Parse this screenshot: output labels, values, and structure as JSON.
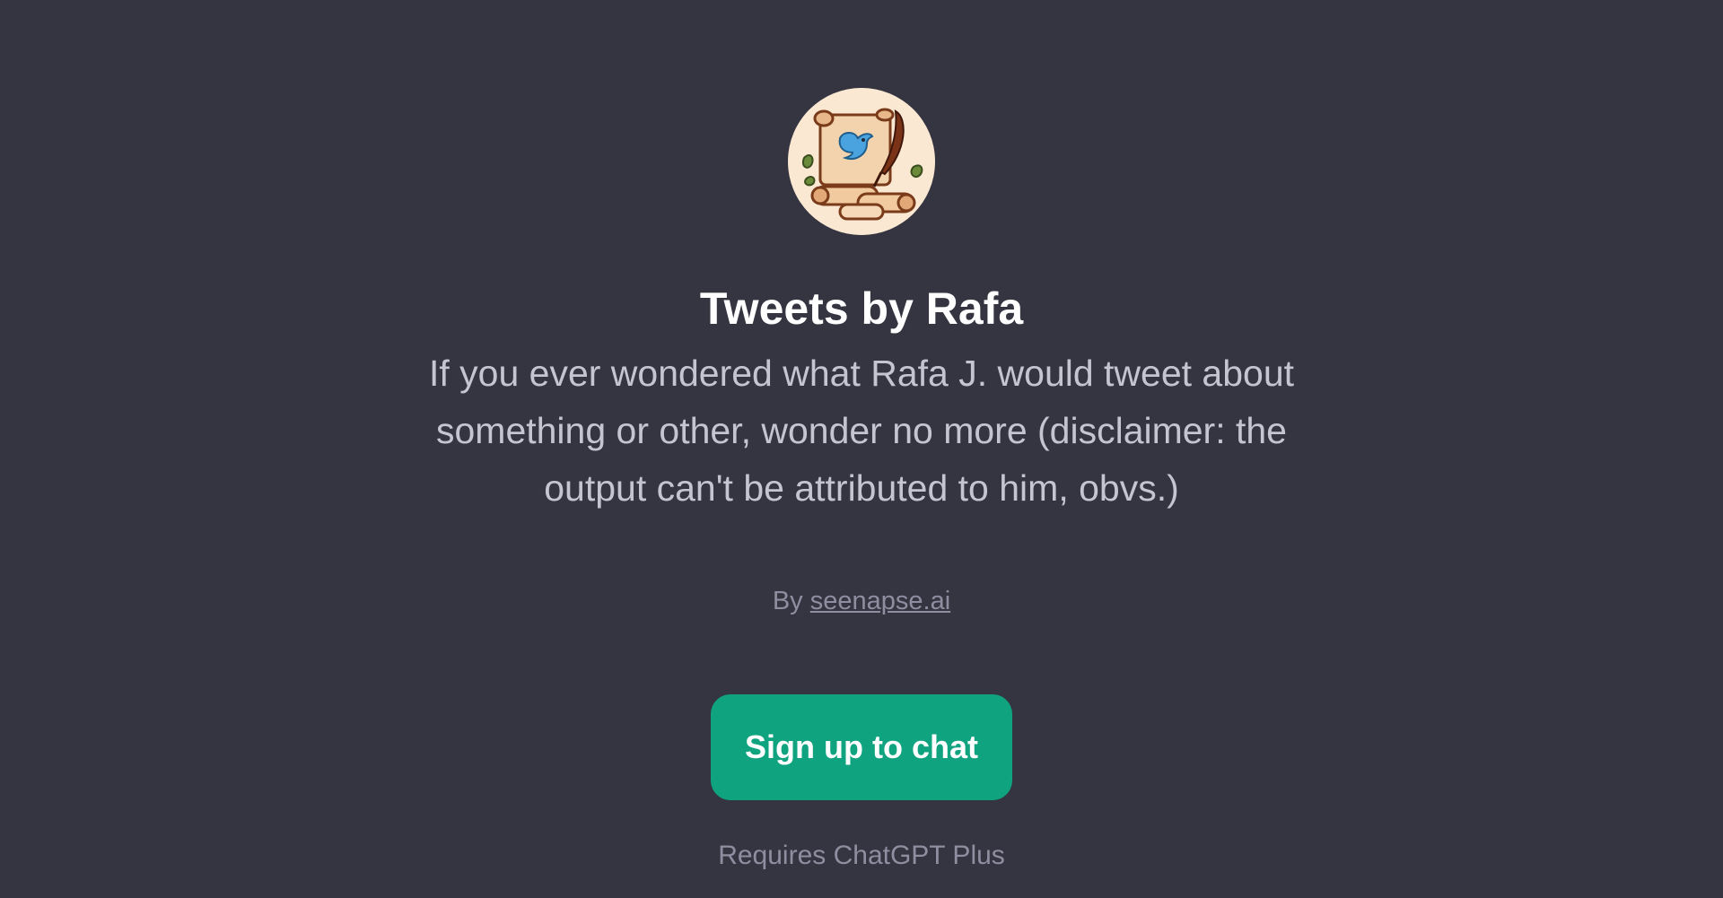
{
  "gpt": {
    "avatar_icon": "scroll-quill-bird-icon",
    "name": "Tweets by Rafa",
    "description": "If you ever wondered what Rafa J. would tweet about something or other, wonder no more (disclaimer: the output can't be attributed to him, obvs.)",
    "by_prefix": "By",
    "author": "seenapse.ai"
  },
  "actions": {
    "signup_label": "Sign up to chat",
    "requirement": "Requires ChatGPT Plus"
  },
  "colors": {
    "background": "#343541",
    "accent": "#10a37f",
    "title": "#ffffff",
    "description": "#c5c5d2",
    "muted": "#8e8ea0"
  }
}
